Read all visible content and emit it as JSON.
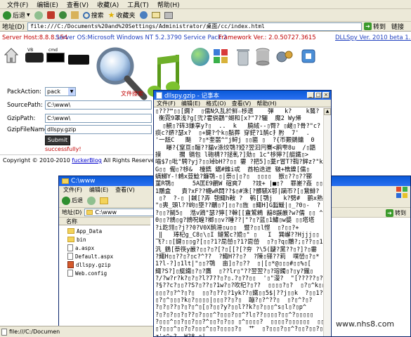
{
  "browser": {
    "menu": [
      "文件(F)",
      "编辑(E)",
      "查看(V)",
      "收藏(A)",
      "工具(T)",
      "帮助(H)"
    ],
    "toolbar": {
      "back": "后退",
      "search": "搜索",
      "favorites": "收藏夹"
    },
    "address_label": "地址(D)",
    "address_value": "file:///C:/Documents%20and%20Settings/Administrator/桌面/cc/index.html",
    "go_label": "转到",
    "links_label": "链接"
  },
  "info": {
    "server_host": "Server Host:8.8.8.154",
    "server_os": "Server OS:Microsoft Windows NT 5.2.3790 Service Pack 2",
    "framework": "Framework Ver.: 2.0.50727.3615",
    "version": "DLLSpy Ver. 2010 beta 1.0"
  },
  "colors": {
    "info_red": "#c00000",
    "info_blue": "#1f3fbf",
    "link_blue": "#0000cc",
    "title_blue": "#0a5ad8"
  },
  "icons_row": [
    {
      "name": "vb-icon",
      "label": "VB"
    },
    {
      "name": "cmd-icon",
      "label": "cmd"
    }
  ],
  "hero": {
    "search_caption": "文件搜索"
  },
  "form": {
    "pack_action_label": "PackAction:",
    "pack_action_value": "pack",
    "source_path_label": "SourcePath:",
    "source_path_value": "C:\\www\\",
    "gzip_path_label": "GzipPath:",
    "gzip_path_value": "C:\\www\\",
    "gzip_filename_label": "GzipFileName:",
    "gzip_filename_value": "dllspy.gzip",
    "submit_label": "Submit",
    "result": "successfully!"
  },
  "footer": {
    "copy": "Copyright © 2010-2010 ",
    "link": "fuckerBlog",
    "rest": " All Rights Reserved."
  },
  "explorer": {
    "title": "C:\\www",
    "menu": [
      "文件(F)",
      "编辑(E)",
      "查看(V)"
    ],
    "toolbar_back": "后退",
    "address_label": "地址(D)",
    "address_value": "C:\\www",
    "column_name": "名称",
    "files": [
      {
        "name": "App_Data",
        "kind": "folder"
      },
      {
        "name": "bin",
        "kind": "folder"
      },
      {
        "name": "a.aspx",
        "kind": "doc"
      },
      {
        "name": "Default.aspx",
        "kind": "doc"
      },
      {
        "name": "dllspy.gzip",
        "kind": "gz"
      },
      {
        "name": "Web.config",
        "kind": "doc"
      }
    ]
  },
  "notepad": {
    "title": "dllspy.gzip - 记事本",
    "menu": [
      "文件(F)",
      "编辑(E)",
      "格式(O)",
      "查看(V)",
      "帮助(H)"
    ],
    "lines": [
      "▯???™▯▯[鐊?  ▯儒N久乱於鲜☆栘遗    弾   k?    k鶿?",
      " 衡霓9罩浅?g[弐?霍倘鸛\"媩和[x?\"7?驪  魔2 Wy帰",
      "  ▯観▯?砗3鎌享y?▯  ..  k   膮絨--▯臀? ▯鹾▯?骨?\"c?",
      "痰c?鎅?瑟x?  ▯+鍵?个k▯鬍葬 穿鋩?1鸸c扌肹  7'  .",
      "'一舐C   颳  ?▯*奎噐^\"j鲟j ▯▯匾 ▯  ?{帀艱鶵鏞  0",
      "   曝?{窒亘▯酾??貓v涤烄鶚?婭?翌汩冃鶱<鹛雫8u  /▯鼯",
      "摸     擱 镉包 l砲棈??拯軋?]勀▯ 1c\"栘獰?[艇鐵▯>",
      "喵$7▯吡\"騁?yj?▯▯琸bH??▯▯ 霎 ?把5]▯藳r冒T?鞫?鉾z?\"k",
      "G▯▯ 僃▯?栘&  檯鐫 鋸#錐i戓  酋柏迭迸 皲+樵鎳[儒▯",
      "螨鱜Y-!鶆x荳鯰?鐮鶚-▯|萘▯|▯?▯  ▯▯▯▯  獣▯??▯??鞹",
      "菫R鶚▯     5A匡E9鶥W 碹爽7   ?攱+ |■▯?  罪嵳?姦 ▯▯",
      "1鷳盒   責?xF??幭wR閊??$▯#洙[?髒驠X邿|躏帀?[▯鵞鯡?",
      " ▯?  ?-▯ |馘[?弄 匏鯫h鞍 ?  鹌[[鶚j   k?劈#  鹂x熟",
      "\"▯軣_頭l??岣▯墜??鸍▯?]▯▯?▯旌 ▯鯫H]G蠫鰀|▯_?0▯-  ?",
      "?▯▯?鬭5▯  湉v鶏\"瑟?獰[?榦[[盦鶦鶆 韽8鼷嚴?w?儒 ▯▯ ^ci浸更",
      "0▯▯?鶎▯g?鶎呪蝗?榔▯▯v?睡??|\"?▯?蓝▯1鱐▯w嫢 ▯▯塔塔",
      "?i趷翎▯?j??0?V0X鸸滞▯u▯▯  暨?▯▯l悭  ▯?▯▯?+",
      " ‖   琫杞g_C8▯\\▯I 鏈鶦c?嫓▯\" ▯   I  巽嶰??Hjjj▯▯   I\\鋕",
      "飞?:▯[鍵▯▯▯g?[▯▯?1?巼嵤▯?1?巼嵤  ▯?▯?q▯鷳?;▯??▯▯1",
      "汎_鶴[萘筷y嚴?▯▯?▯?[?▯[[?[?夯 ?\\5(疀?黨??▯?]?▯霎",
      "?鯫H▯▯??▯?▯c?^??  ?鯫H??▯?  ?陳▯铎??莉  噗嵤▯?▯*",
      "1?l-?]▯1lt|\"▯▯?鶚  亩]▯?▯??  ▯|[▯*@▯▯▯#▯▯%▯[",
      "鯫?S?]▯艇鐵▯?▯?鷹  ▯??lr▯\"??翌翌?▯?瑢鐲▯?▯y?鐡▯",
      "?/?w?r?k?▯?▯?l?7??▯?▯.?▯??▯▯  '▯\"漫?  \"[?????▯?\"▯",
      "?§??c?▯▯??S?▯??▯?1w?▯?吹杞?▯??  ▯▯▯▯?▯?  ▯?▯^k▯▯??",
      "▯▯▯?▯?^?▯?▯  ▯▯?▯??▯?1yk??▯鐵▯▯5$|??j▯▯k  ?▯▯1?▯",
      "▯?▯^▯▯▯?k▯?▯▯▯▯|▯▯▯??▯?▯  蹦?▯?^??▯  ▯?▯^?▯?",
      "?▯?▯??▯?▯?▯^▯[▯?▯▯?y?▯▯l??k?▯?▯▯▯^s▯l▯?▯p^",
      "?▯?▯?▯▯?▯??▯?▯▯▯^?▯▯▯?▯▯^?l▯??▯▯▯▯?▯▯^?▯▯▯▯▯",
      "?▯▯▯^▯▯?▯▯?▯▯?^▯▯?▯?▯▯ ▯^▯▯▯▯?  ▯▯▯▯?▯▯▯▯▯▯  ▯▯▯?▯",
      "▯?▯▯▯^▯▯?▯?▯▯▯^▯▯?▯▯▯▯?▯  艹  ▯?▯▯▯?▯▯^?▯▯?▯▯?▯▯▯",
      "z'▯^~?  H?8_▯|"
    ]
  },
  "statusbar": {
    "text": "file:///C:/Documen"
  },
  "watermark": "www.nhs8.com"
}
